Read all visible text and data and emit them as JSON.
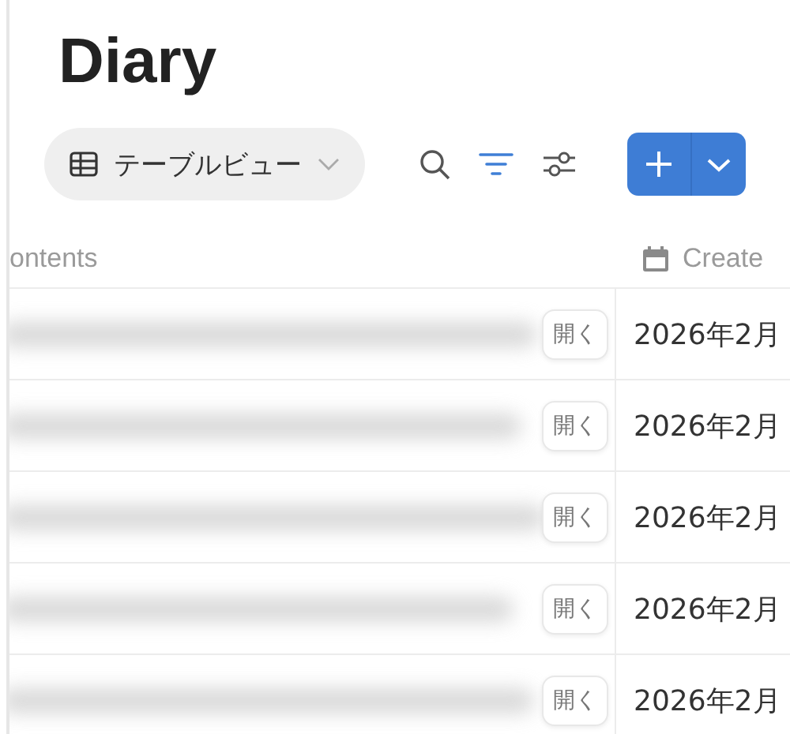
{
  "title": "Diary",
  "view": {
    "label": "テーブルビュー"
  },
  "toolbar": {
    "filter_active": true
  },
  "table": {
    "columns": [
      {
        "label": "ontents",
        "kind": "text"
      },
      {
        "label": "Create",
        "kind": "date"
      }
    ],
    "rows": [
      {
        "open": "開く",
        "created": "2026年2月"
      },
      {
        "open": "開く",
        "created": "2026年2月"
      },
      {
        "open": "開く",
        "created": "2026年2月"
      },
      {
        "open": "開く",
        "created": "2026年2月"
      },
      {
        "open": "開く",
        "created": "2026年2月"
      }
    ]
  }
}
